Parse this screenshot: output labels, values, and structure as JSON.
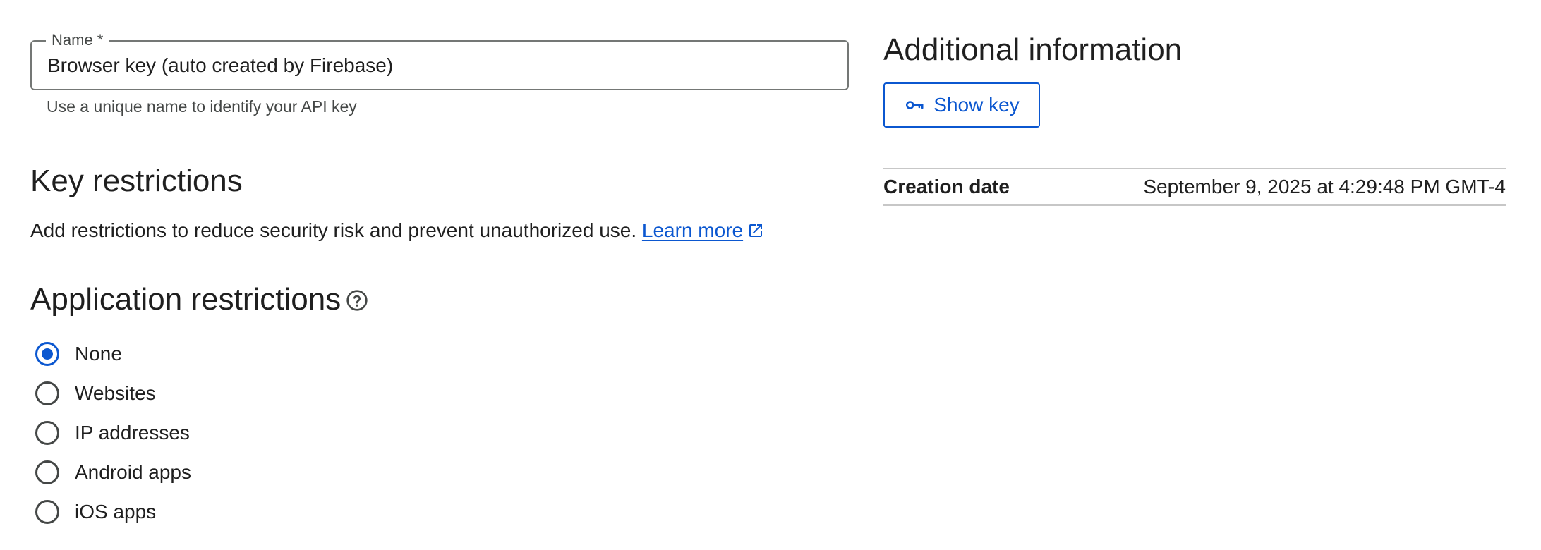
{
  "name_field": {
    "label": "Name *",
    "value": "Browser key (auto created by Firebase)",
    "hint": "Use a unique name to identify your API key"
  },
  "key_restrictions": {
    "title": "Key restrictions",
    "description": "Add restrictions to reduce security risk and prevent unauthorized use.",
    "learn_more": "Learn more"
  },
  "application_restrictions": {
    "title": "Application restrictions",
    "help_icon": "help-circle-icon",
    "options": [
      {
        "label": "None",
        "selected": true
      },
      {
        "label": "Websites",
        "selected": false
      },
      {
        "label": "IP addresses",
        "selected": false
      },
      {
        "label": "Android apps",
        "selected": false
      },
      {
        "label": "iOS apps",
        "selected": false
      }
    ]
  },
  "additional_information": {
    "title": "Additional information",
    "show_key_label": "Show key",
    "creation_date_label": "Creation date",
    "creation_date_value": "September 9, 2025 at 4:29:48 PM GMT-4"
  },
  "colors": {
    "accent": "#0b57d0",
    "text": "#1f1f1f",
    "secondary_text": "#444746",
    "border": "#747775",
    "divider": "#c7c7c7"
  }
}
